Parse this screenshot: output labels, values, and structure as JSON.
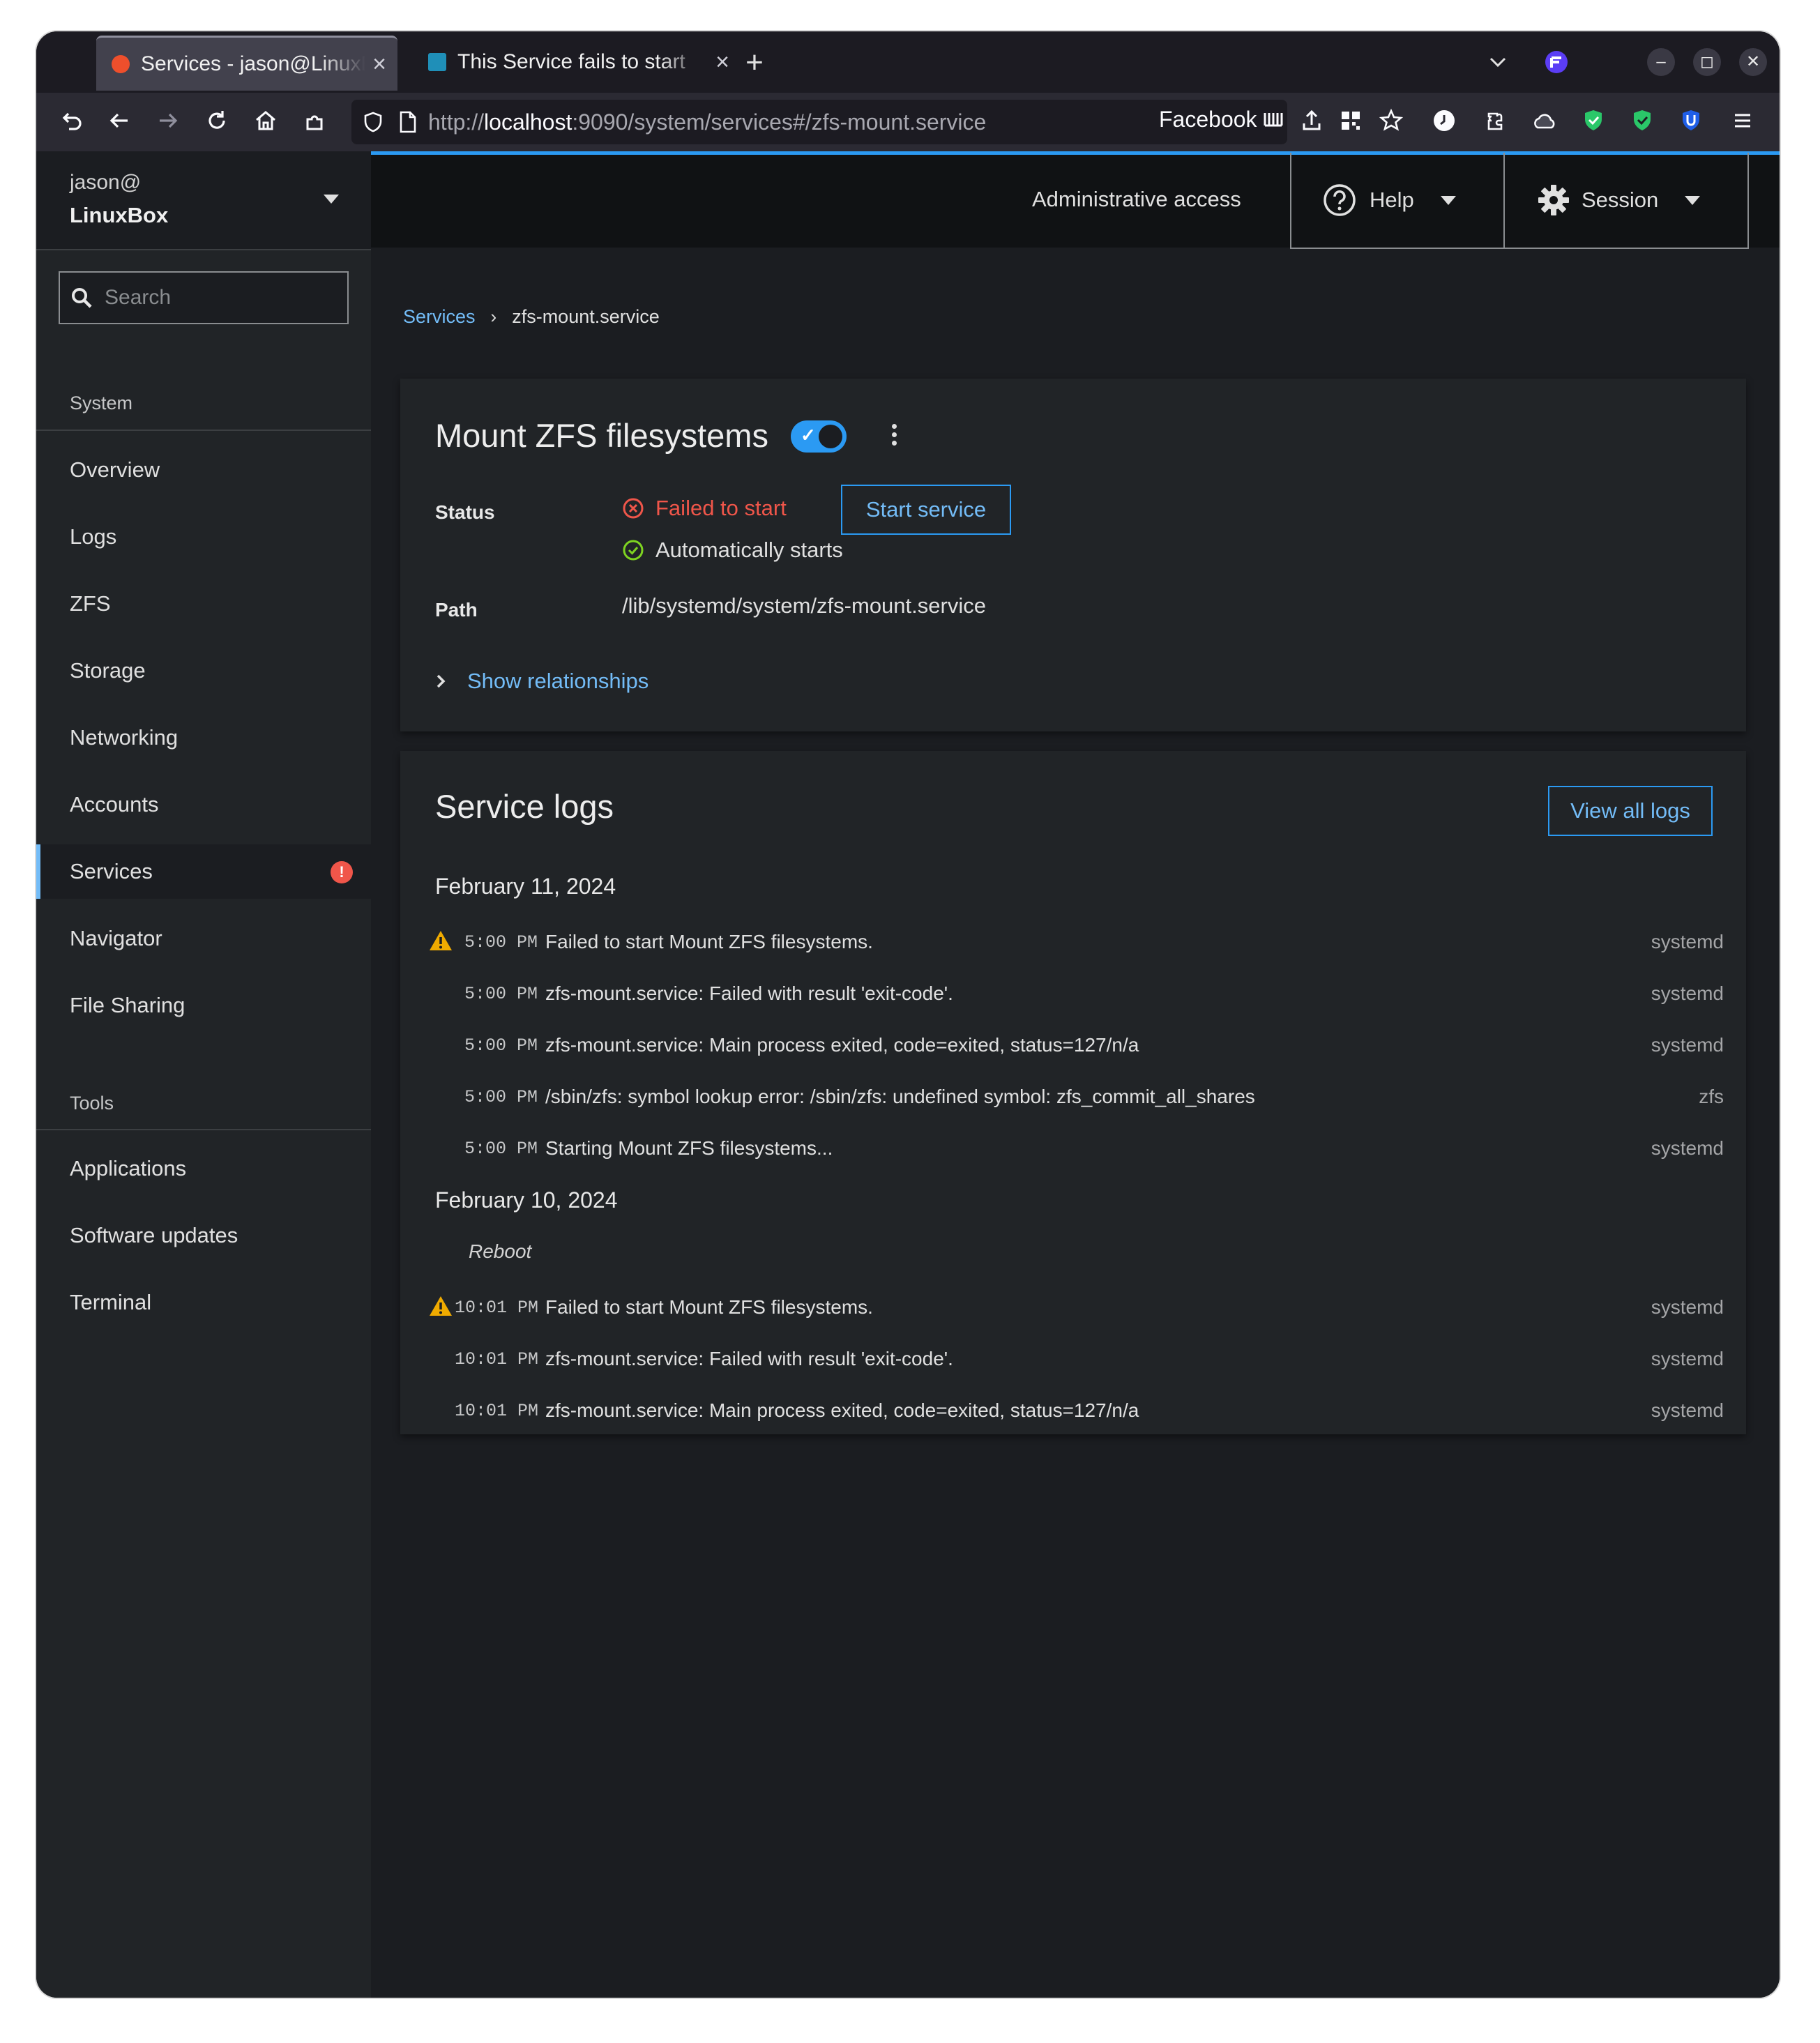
{
  "browser": {
    "tabs": [
      {
        "label": "Services - jason@LinuxBox",
        "favicon_color": "#ee4f2c"
      },
      {
        "label": "This Service fails to start",
        "favicon_color": "#1f8fb8"
      }
    ],
    "new_tab": "+",
    "close": "×",
    "url_prefix": "http://",
    "url_host": "localhost",
    "url_rest": ":9090/system/services#/zfs-mount.service",
    "bookmark_label": "Facebook",
    "window_controls": {
      "minimize": "–",
      "maximize": "◻",
      "close": "✕"
    }
  },
  "sidebar": {
    "user": "jason@",
    "host": "LinuxBox",
    "search_placeholder": "Search",
    "system_header": "System",
    "system_items": [
      "Overview",
      "Logs",
      "ZFS",
      "Storage",
      "Networking",
      "Accounts",
      "Services",
      "Navigator",
      "File Sharing"
    ],
    "active_item": "Services",
    "services_badge": "!",
    "tools_header": "Tools",
    "tools_items": [
      "Applications",
      "Software updates",
      "Terminal"
    ]
  },
  "masthead": {
    "admin_access": "Administrative access",
    "help": "Help",
    "session": "Session"
  },
  "breadcrumb": {
    "parent": "Services",
    "current": "zfs-mount.service"
  },
  "service": {
    "title": "Mount ZFS filesystems",
    "enabled": true,
    "status_label": "Status",
    "status_failed": "Failed to start",
    "status_auto": "Automatically starts",
    "start_button": "Start service",
    "path_label": "Path",
    "path": "/lib/systemd/system/zfs-mount.service",
    "relationships": "Show relationships"
  },
  "logs": {
    "title": "Service logs",
    "view_all": "View all logs",
    "reboot_label": "Reboot",
    "groups": [
      {
        "date": "February 11, 2024",
        "entries": [
          {
            "warn": true,
            "time": "5:00 PM",
            "msg": "Failed to start Mount ZFS filesystems.",
            "source": "systemd"
          },
          {
            "warn": false,
            "time": "5:00 PM",
            "msg": "zfs-mount.service: Failed with result 'exit-code'.",
            "source": "systemd"
          },
          {
            "warn": false,
            "time": "5:00 PM",
            "msg": "zfs-mount.service: Main process exited, code=exited, status=127/n/a",
            "source": "systemd"
          },
          {
            "warn": false,
            "time": "5:00 PM",
            "msg": "/sbin/zfs: symbol lookup error: /sbin/zfs: undefined symbol: zfs_commit_all_shares",
            "source": "zfs"
          },
          {
            "warn": false,
            "time": "5:00 PM",
            "msg": "Starting Mount ZFS filesystems...",
            "source": "systemd"
          }
        ]
      },
      {
        "date": "February 10, 2024",
        "entries": [
          {
            "warn": true,
            "time": "10:01 PM",
            "msg": "Failed to start Mount ZFS filesystems.",
            "source": "systemd"
          },
          {
            "warn": false,
            "time": "10:01 PM",
            "msg": "zfs-mount.service: Failed with result 'exit-code'.",
            "source": "systemd"
          },
          {
            "warn": false,
            "time": "10:01 PM",
            "msg": "zfs-mount.service: Main process exited, code=exited, status=127/n/a",
            "source": "systemd"
          }
        ]
      }
    ]
  },
  "colors": {
    "accent": "#2b9af3",
    "link": "#73bcf7",
    "danger": "#f0564a",
    "success": "#7ed321",
    "warning": "#f0ab00"
  }
}
